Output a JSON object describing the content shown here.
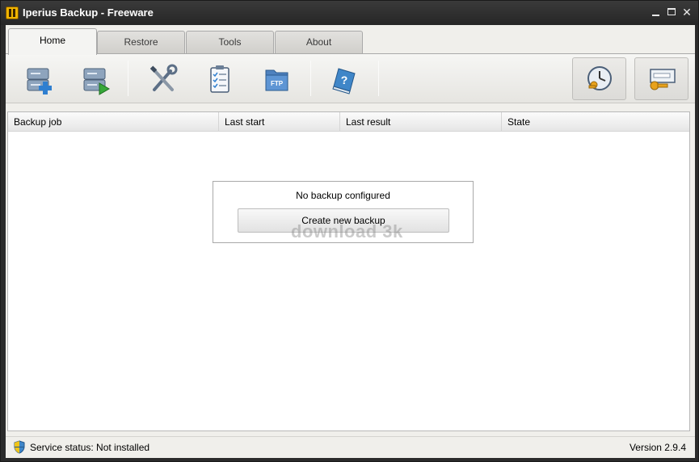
{
  "window": {
    "title": "Iperius Backup - Freeware"
  },
  "tabs": [
    {
      "label": "Home"
    },
    {
      "label": "Restore"
    },
    {
      "label": "Tools"
    },
    {
      "label": "About"
    }
  ],
  "toolbar": {
    "buttons": [
      {
        "icon": "new-backup-icon"
      },
      {
        "icon": "run-backup-icon"
      },
      {
        "icon": "tools-icon"
      },
      {
        "icon": "checklist-icon"
      },
      {
        "icon": "ftp-icon",
        "label": "FTP"
      },
      {
        "icon": "help-book-icon"
      }
    ],
    "right_buttons": [
      {
        "icon": "scheduler-clock-icon"
      },
      {
        "icon": "license-key-icon"
      }
    ]
  },
  "list": {
    "columns": [
      "Backup job",
      "Last start",
      "Last result",
      "State"
    ],
    "empty_message": "No backup configured",
    "create_button": "Create new backup",
    "watermark": "download 3k"
  },
  "status": {
    "service": "Service status: Not installed",
    "version": "Version 2.9.4"
  },
  "colors": {
    "accent": "#3f86c8",
    "window_bg": "#f0efeb",
    "titlebar": "#2b2b2b"
  }
}
